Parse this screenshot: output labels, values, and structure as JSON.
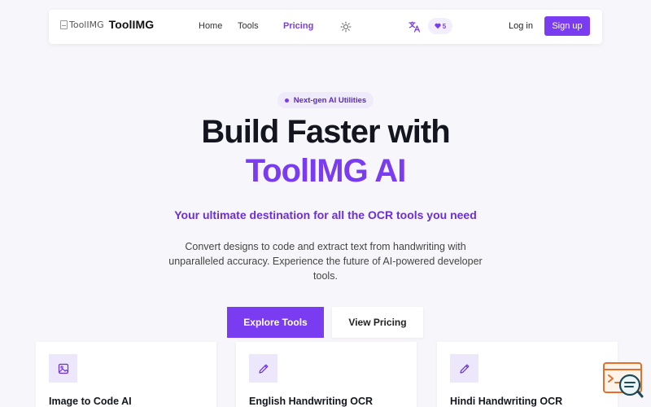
{
  "nav": {
    "logo_alt": "ToolIMG",
    "brand": "ToolIMG",
    "links": [
      "Home",
      "Tools",
      "Pricing"
    ],
    "active_link": "Pricing",
    "likes_count": "5",
    "login": "Log in",
    "signup": "Sign up"
  },
  "hero": {
    "badge": "Next-gen AI Utilities",
    "title_line1": "Build Faster with",
    "title_line2": "ToolIMG AI",
    "tagline": "Your ultimate destination for all the OCR tools you need",
    "description": "Convert designs to code and extract text from handwriting with unparalleled accuracy. Experience the future of AI-powered developer tools.",
    "primary_cta": "Explore Tools",
    "secondary_cta": "View Pricing"
  },
  "cards": [
    {
      "title": "Image to Code AI",
      "icon": "image-icon"
    },
    {
      "title": "English Handwriting OCR",
      "icon": "pencil-icon"
    },
    {
      "title": "Hindi Handwriting OCR",
      "icon": "pencil-icon"
    }
  ],
  "colors": {
    "accent": "#7a3cf0",
    "background": "#f7f6fa",
    "card_icon_bg": "#ede7fb"
  }
}
